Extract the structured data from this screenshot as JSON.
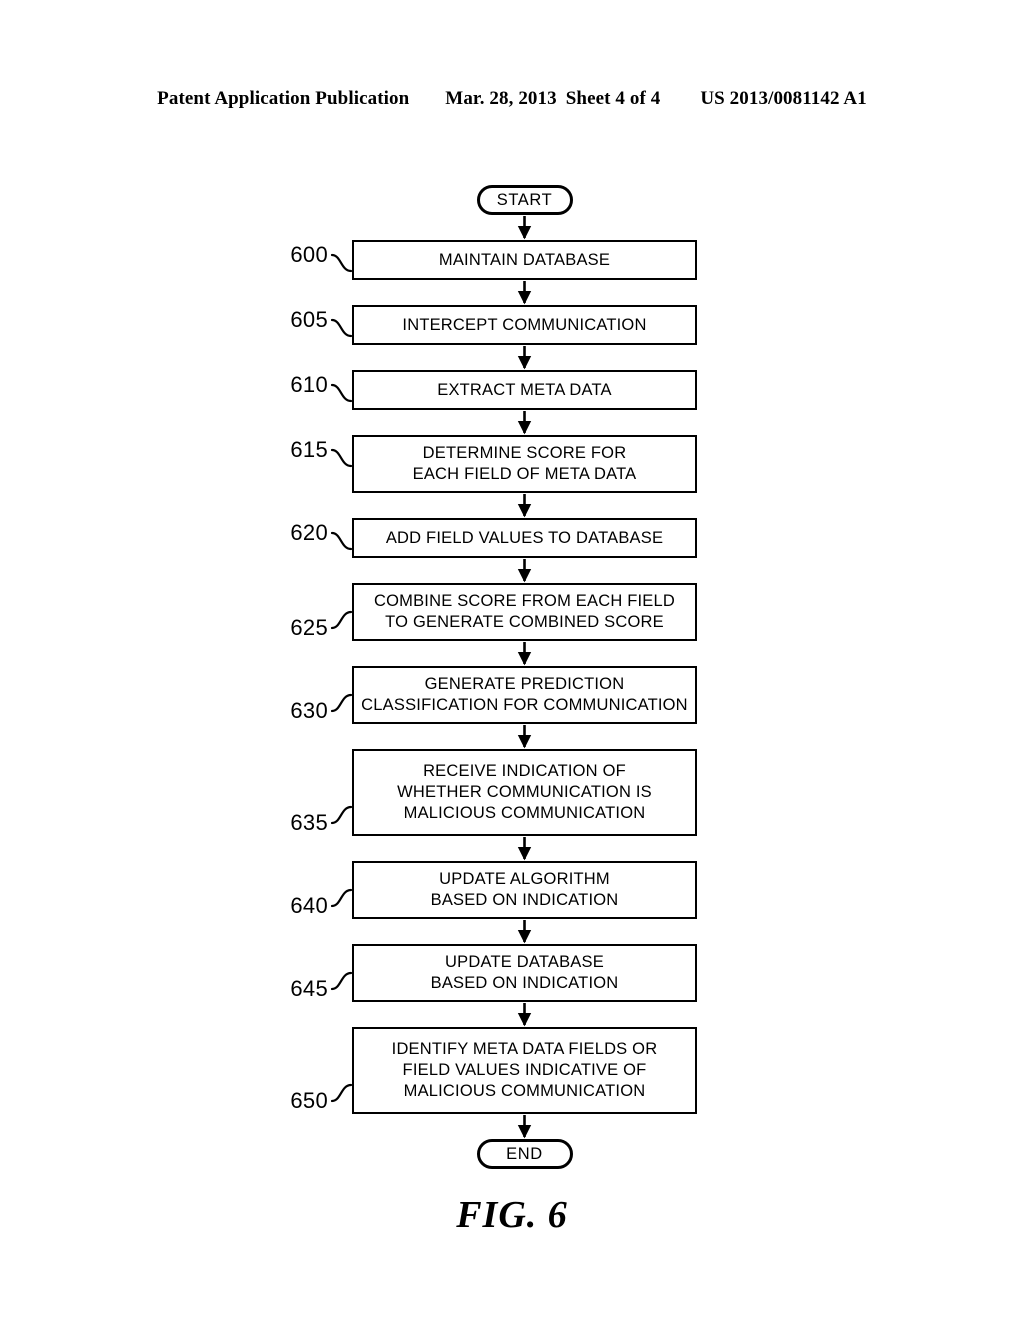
{
  "header": {
    "left": "Patent Application Publication",
    "date": "Mar. 28, 2013",
    "sheet": "Sheet 4 of 4",
    "right": "US 2013/0081142 A1"
  },
  "figure": {
    "caption": "FIG. 6",
    "start_label": "START",
    "end_label": "END",
    "steps": [
      {
        "ref": "600",
        "text": "MAINTAIN DATABASE",
        "lines": 1,
        "leader": "down"
      },
      {
        "ref": "605",
        "text": "INTERCEPT COMMUNICATION",
        "lines": 1,
        "leader": "down"
      },
      {
        "ref": "610",
        "text": "EXTRACT META DATA",
        "lines": 1,
        "leader": "down"
      },
      {
        "ref": "615",
        "text": "DETERMINE SCORE FOR\nEACH FIELD OF META DATA",
        "lines": 2,
        "leader": "down"
      },
      {
        "ref": "620",
        "text": "ADD FIELD VALUES TO DATABASE",
        "lines": 1,
        "leader": "down"
      },
      {
        "ref": "625",
        "text": "COMBINE SCORE FROM EACH FIELD\nTO GENERATE COMBINED SCORE",
        "lines": 2,
        "leader": "up"
      },
      {
        "ref": "630",
        "text": "GENERATE PREDICTION\nCLASSIFICATION FOR COMMUNICATION",
        "lines": 2,
        "leader": "up"
      },
      {
        "ref": "635",
        "text": "RECEIVE INDICATION OF\nWHETHER COMMUNICATION IS\nMALICIOUS COMMUNICATION",
        "lines": 3,
        "leader": "up"
      },
      {
        "ref": "640",
        "text": "UPDATE ALGORITHM\nBASED ON INDICATION",
        "lines": 2,
        "leader": "up"
      },
      {
        "ref": "645",
        "text": "UPDATE DATABASE\nBASED ON INDICATION",
        "lines": 2,
        "leader": "up"
      },
      {
        "ref": "650",
        "text": "IDENTIFY META DATA FIELDS OR\nFIELD VALUES INDICATIVE OF\nMALICIOUS COMMUNICATION",
        "lines": 3,
        "leader": "up"
      }
    ]
  },
  "colors": {
    "ink": "#000000",
    "paper": "#ffffff"
  }
}
